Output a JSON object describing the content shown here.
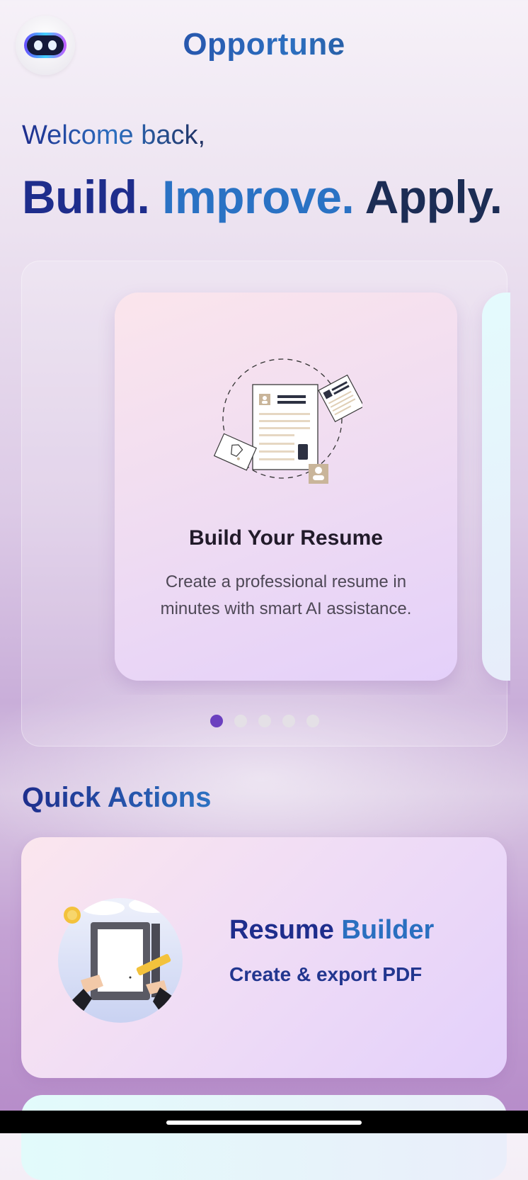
{
  "header": {
    "app_title": "Opportune",
    "avatar_icon": "robot-icon"
  },
  "hero": {
    "welcome": "Welcome back,",
    "tagline": [
      "Build.",
      "Improve.",
      "Apply."
    ]
  },
  "carousel": {
    "active_index": 0,
    "slide_count": 5,
    "slides": [
      {
        "icon": "resume-document-icon",
        "title": "Build Your Resume",
        "description": "Create a professional resume in minutes with smart AI assistance."
      }
    ]
  },
  "quick_actions": {
    "title": "Quick Actions",
    "items": [
      {
        "title_parts": [
          "Resume",
          "Builder"
        ],
        "subtitle": "Create & export PDF",
        "icon": "resume-builder-illustration"
      }
    ]
  },
  "colors": {
    "brand_dark": "#1e2d8c",
    "brand_blue": "#2a72c4",
    "accent_purple": "#6b40bf"
  }
}
